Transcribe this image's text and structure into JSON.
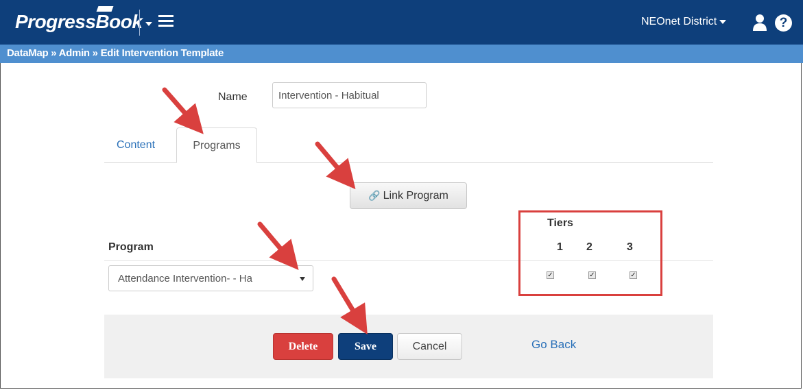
{
  "header": {
    "logo_text": "ProgressBook",
    "district": "NEOnet District",
    "help_glyph": "?"
  },
  "breadcrumb": "DataMap » Admin » Edit Intervention Template",
  "form": {
    "name_label": "Name",
    "name_value": "Intervention - Habitual"
  },
  "tabs": [
    {
      "label": "Content",
      "active": false
    },
    {
      "label": "Programs",
      "active": true
    }
  ],
  "link_program_label": "Link Program",
  "program": {
    "label": "Program",
    "selected": "Attendance Intervention- - Ha"
  },
  "tiers": {
    "title": "Tiers",
    "numbers": [
      "1",
      "2",
      "3"
    ],
    "checked": [
      true,
      true,
      true
    ]
  },
  "actions": {
    "delete": "Delete",
    "save": "Save",
    "cancel": "Cancel",
    "go_back": "Go Back"
  },
  "colors": {
    "header": "#0e3f7b",
    "breadcrumb": "#4f8fcf",
    "annotation": "#d9403e",
    "link": "#2a70b8"
  }
}
